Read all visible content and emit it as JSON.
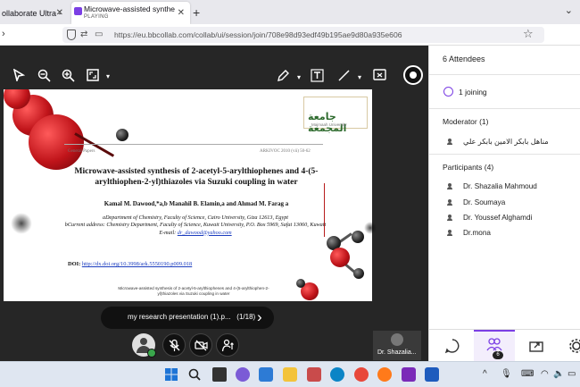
{
  "browser": {
    "tabs": [
      {
        "title": "ollaborate Ultra -",
        "active": false
      },
      {
        "title": "Microwave-assisted synthesis of",
        "subtitle": "PLAYING",
        "active": true
      }
    ],
    "url": "https://eu.bbcollab.com/collab/ui/session/join/708e98d93edf49b195ae9d80a935e606"
  },
  "slide": {
    "university": "جامعة المجمعة",
    "university_sub": "Majmaah University",
    "header_left": "General Papers",
    "header_right": "ARKIVOC 2010 (vii) 50-62",
    "title": "Microwave-assisted synthesis of 2-acetyl-5-arylthiophenes and 4-(5-arylthiophen-2-yl)thiazoles via Suzuki coupling in water",
    "authors": "Kamal M. Dawood,*a,b Manahil B. Elamin,a and Ahmad M. Farag a",
    "affiliation_1": "aDepartment of Chemistry, Faculty of Science, Cairo University, Giza 12613, Egypt",
    "affiliation_2": "bCurrent address: Chemistry Department, Faculty of Science, Kuwait University, P.O. Box 5969, Safat 13060, Kuwait",
    "email_label": "E-mail: ",
    "email": "dr_dawood@yahoo.com",
    "doi_label": "DOI: ",
    "doi": "http://dx.doi.org/10.3998/ark.5550190.p009.018",
    "caption": "Microwave-assisted synthesis of 2-acetyl-5-arylthiophenes and 4-(5-arylthiophen-2-yl)thiazoles via Suzuki coupling in water"
  },
  "slide_nav": {
    "file": "my research presentation (1).p...",
    "page": "(1/18)"
  },
  "speaker_tile": {
    "name": "Dr. Shazalia..."
  },
  "panel": {
    "title": "6 Attendees",
    "joining": "1 joining",
    "moderator_header": "Moderator (1)",
    "moderators": [
      "مناهل بابكر الامين بابكر علي"
    ],
    "participants_header": "Participants (4)",
    "participants": [
      "Dr. Shazalia Mahmoud",
      "Dr. Soumaya",
      "Dr. Youssef Alghamdi",
      "Dr.mona"
    ],
    "badge": "6"
  },
  "colors": {
    "accent": "#7b3fe4",
    "stage": "#262626",
    "status_ok": "#3aa64c"
  }
}
